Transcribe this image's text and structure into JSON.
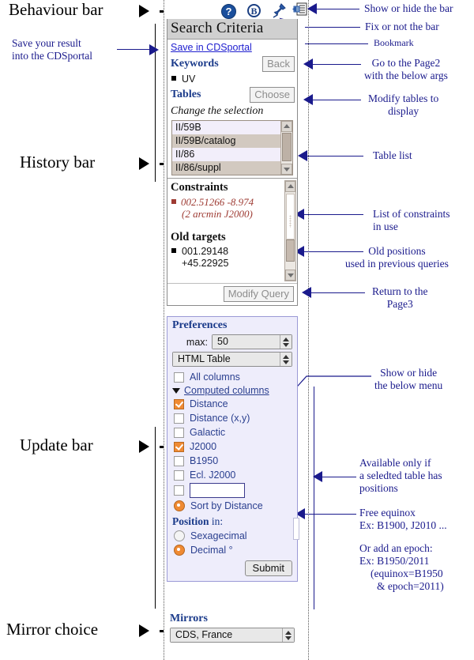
{
  "left_annotations": [
    {
      "id": "behaviour-bar",
      "label": "Behaviour bar"
    },
    {
      "id": "history-bar",
      "label": "History bar"
    },
    {
      "id": "update-bar",
      "label": "Update bar"
    },
    {
      "id": "mirror-choice",
      "label": "Mirror choice"
    }
  ],
  "left_callouts": [
    {
      "id": "save-result",
      "line1": "Save your result",
      "line2": "into the CDSportal"
    }
  ],
  "right_annotations": [
    {
      "id": "show-hide-bar",
      "lines": [
        "Show or hide the bar"
      ]
    },
    {
      "id": "fix-bar",
      "lines": [
        "Fix or not the bar"
      ]
    },
    {
      "id": "bookmark",
      "lines": [
        "Bookmark"
      ]
    },
    {
      "id": "go-page2",
      "lines": [
        "Go to the Page2",
        "with the below args"
      ]
    },
    {
      "id": "modify-tables",
      "lines": [
        "Modify tables to",
        "display"
      ]
    },
    {
      "id": "table-list",
      "lines": [
        "Table list"
      ]
    },
    {
      "id": "list-constraints",
      "lines": [
        "List of constraints",
        "in use"
      ]
    },
    {
      "id": "old-positions",
      "lines": [
        "Old positions",
        "used in previous queries"
      ]
    },
    {
      "id": "return-page3",
      "lines": [
        "Return to the",
        "Page3"
      ]
    },
    {
      "id": "show-hide-menu",
      "lines": [
        "Show or hide",
        "the below menu"
      ]
    },
    {
      "id": "available-positions",
      "lines": [
        "Available only if",
        "a seledted table has",
        "positions"
      ]
    },
    {
      "id": "free-equinox",
      "lines": [
        "Free equinox",
        "Ex: B1900, J2010 ..."
      ]
    },
    {
      "id": "add-epoch",
      "lines": [
        "Or add an epoch:",
        "Ex: B1950/2011",
        "(equinox=B1950",
        "& epoch=2011)"
      ]
    }
  ],
  "toolbar": {
    "help_label": "?",
    "bookmark_label": "B",
    "pin_name": "pushpin-icon",
    "panel_name": "panel-toggle-icon"
  },
  "panel": {
    "title": "Search Criteria",
    "save_link": "Save in CDSportal",
    "keywords_label": "Keywords",
    "back_label": "Back",
    "keyword_value": "UV",
    "tables_label": "Tables",
    "choose_label": "Choose",
    "change_selection": "Change the selection",
    "table_options": [
      {
        "label": "II/59B",
        "selected": false
      },
      {
        "label": "II/59B/catalog",
        "selected": true
      },
      {
        "label": "II/86",
        "selected": false
      },
      {
        "label": "II/86/suppl",
        "selected": true
      }
    ],
    "constraints_label": "Constraints",
    "constraint_value": "002.51266 -8.974",
    "constraint_detail": "(2 arcmin J2000)",
    "old_targets_label": "Old targets",
    "old_target_ra": "001.29148",
    "old_target_dec": "+45.22925",
    "modify_query_label": "Modify Query"
  },
  "preferences": {
    "title": "Preferences",
    "max_label": "max:",
    "max_value": "50",
    "format_value": "HTML Table",
    "all_columns": {
      "label": "All columns",
      "checked": false
    },
    "computed_columns_label": "Computed columns",
    "columns": [
      {
        "label": "Distance",
        "checked": true
      },
      {
        "label": "Distance (x,y)",
        "checked": false
      },
      {
        "label": "Galactic",
        "checked": false
      },
      {
        "label": "J2000",
        "checked": true
      },
      {
        "label": "B1950",
        "checked": false
      },
      {
        "label": "Ecl. J2000",
        "checked": false
      }
    ],
    "equinox_value": "",
    "sort_label": "Sort by Distance",
    "sort_selected": true,
    "position_label_bold": "Position",
    "position_label_rest": " in:",
    "position_options": [
      {
        "label": "Sexagecimal",
        "selected": false
      },
      {
        "label": "Decimal °",
        "selected": true
      }
    ],
    "submit_label": "Submit"
  },
  "mirrors": {
    "title": "Mirrors",
    "value": "CDS, France"
  },
  "colors": {
    "annotation_navy": "#1a1a8c",
    "heading_blue": "#1a3a8a",
    "link_blue": "#2020d0",
    "constraint_red": "#9e3b33",
    "checked_orange": "#ef8a33",
    "prefs_bg": "#eeedfb"
  }
}
